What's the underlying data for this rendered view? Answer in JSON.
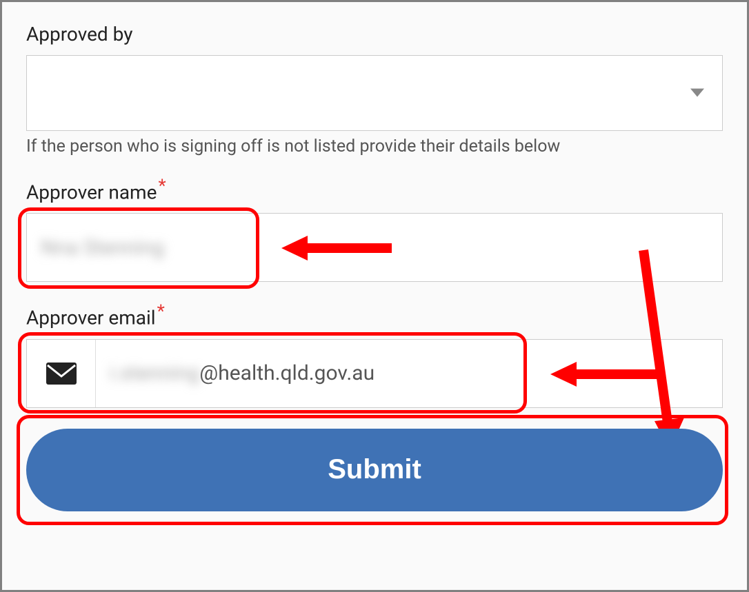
{
  "fields": {
    "approved_by": {
      "label": "Approved by",
      "hint": "If the person who is signing off is not listed provide their details below",
      "value": ""
    },
    "approver_name": {
      "label": "Approver name",
      "required": true,
      "value_blurred": "Nna Stenning"
    },
    "approver_email": {
      "label": "Approver email",
      "required": true,
      "value_blurred_prefix": "i.stenning",
      "value_visible_suffix": "@health.qld.gov.au"
    }
  },
  "submit": {
    "label": "Submit"
  },
  "colors": {
    "highlight": "#ff0000",
    "button_bg": "#3f72b5",
    "asterisk": "#e53935"
  }
}
